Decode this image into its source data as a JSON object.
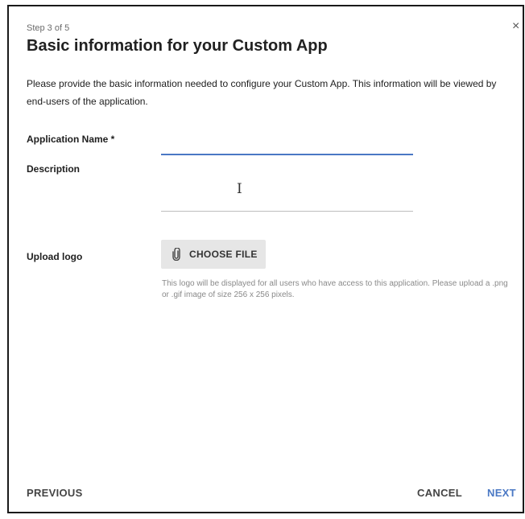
{
  "dialog": {
    "step": "Step 3 of 5",
    "title": "Basic information for your Custom App",
    "close_glyph": "×",
    "intro": "Please provide the basic information needed to configure your Custom App. This information will be viewed by end-users of the application."
  },
  "form": {
    "app_name": {
      "label": "Application Name *",
      "value": ""
    },
    "description": {
      "label": "Description",
      "value": ""
    },
    "logo": {
      "label": "Upload logo",
      "button_label": "CHOOSE FILE",
      "icon": "paperclip-icon",
      "hint": "This logo will be displayed for all users who have access to this application. Please upload a .png or .gif image of size 256 x 256 pixels."
    }
  },
  "footer": {
    "previous": "PREVIOUS",
    "cancel": "CANCEL",
    "next": "NEXT"
  },
  "colors": {
    "accent": "#4a78c4",
    "border": "#1a1a1a",
    "button_bg": "#e6e6e6"
  }
}
